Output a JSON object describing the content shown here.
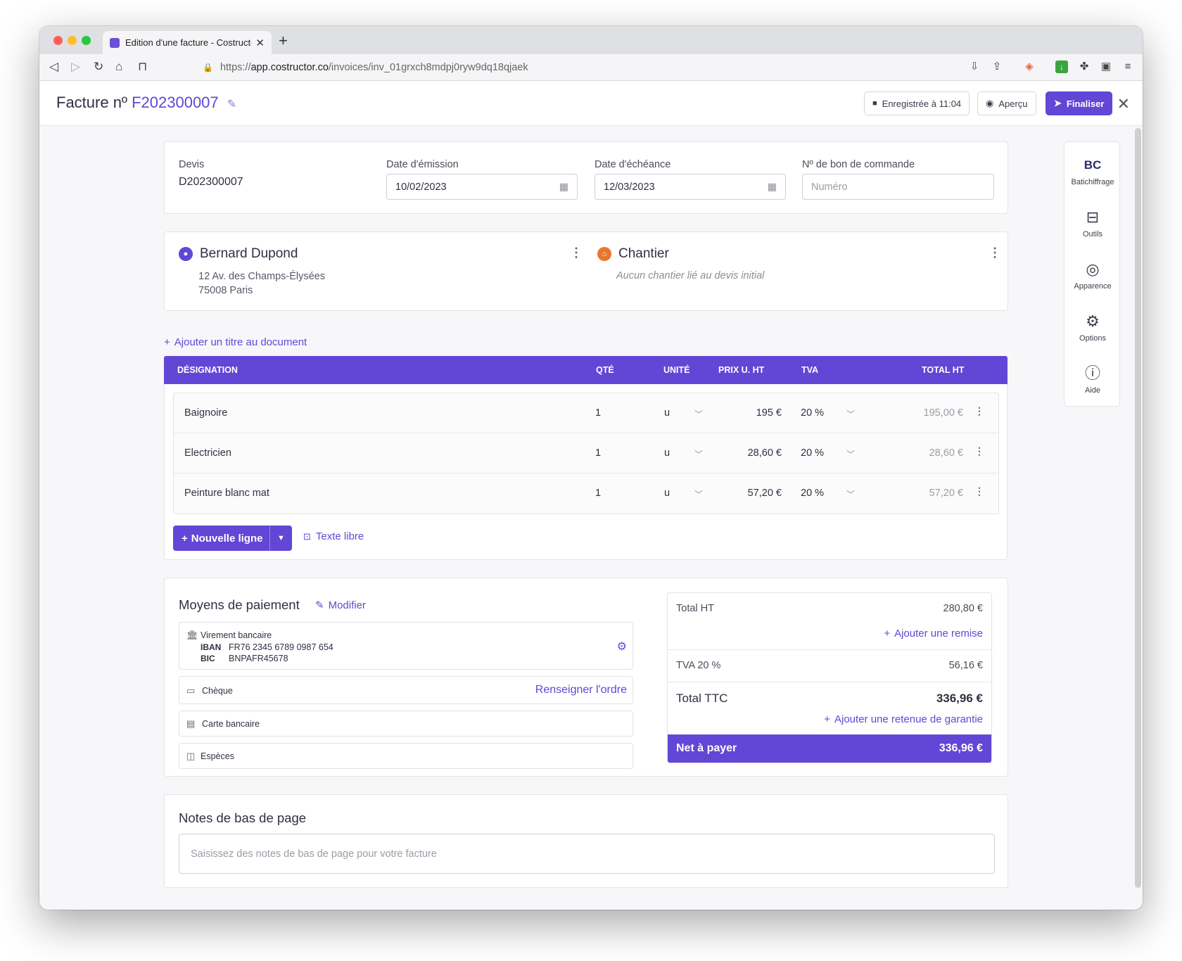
{
  "browser": {
    "tab_title": "Edition d'une facture - Costructor",
    "url_scheme": "https://",
    "url_host": "app.costructor.co",
    "url_path": "/invoices/inv_01grxch8mdpj0ryw9dq18qjaek"
  },
  "header": {
    "title_prefix": "Facture nº",
    "invoice_number": "F202300007",
    "saved_label": "Enregistrée à 11:04",
    "preview_label": "Aperçu",
    "finalize_label": "Finaliser"
  },
  "meta": {
    "quote_label": "Devis",
    "quote_value": "D202300007",
    "issue_label": "Date d'émission",
    "issue_value": "10/02/2023",
    "due_label": "Date d'échéance",
    "due_value": "12/03/2023",
    "po_label": "Nº de bon de commande",
    "po_placeholder": "Numéro"
  },
  "client": {
    "name": "Bernard Dupond",
    "address_line1": "12 Av. des Champs-Élysées",
    "address_line2": "75008 Paris"
  },
  "site": {
    "name": "Chantier",
    "empty_text": "Aucun chantier lié au devis initial"
  },
  "add_title_label": "Ajouter un titre au document",
  "table": {
    "headers": {
      "designation": "DÉSIGNATION",
      "qty": "QTÉ",
      "unit": "UNITÉ",
      "price": "PRIX U. HT",
      "vat": "TVA",
      "total": "TOTAL HT"
    },
    "rows": [
      {
        "designation": "Baignoire",
        "qty": "1",
        "unit": "u",
        "price": "195 €",
        "vat": "20 %",
        "total": "195,00 €"
      },
      {
        "designation": "Electricien",
        "qty": "1",
        "unit": "u",
        "price": "28,60 €",
        "vat": "20 %",
        "total": "28,60 €"
      },
      {
        "designation": "Peinture blanc mat",
        "qty": "1",
        "unit": "u",
        "price": "57,20 €",
        "vat": "20 %",
        "total": "57,20 €"
      }
    ],
    "new_line_label": "Nouvelle ligne",
    "free_text_label": "Texte libre"
  },
  "payment": {
    "title": "Moyens de paiement",
    "edit_label": "Modifier",
    "transfer_label": "Virement bancaire",
    "iban_label": "IBAN",
    "iban_value": "FR76 2345 6789 0987 654",
    "bic_label": "BIC",
    "bic_value": "BNPAFR45678",
    "cheque_label": "Chèque",
    "cheque_action": "Renseigner l'ordre",
    "card_label": "Carte bancaire",
    "cash_label": "Espèces"
  },
  "totals": {
    "total_ht_label": "Total HT",
    "total_ht_value": "280,80 €",
    "add_discount_label": "Ajouter une remise",
    "vat_label": "TVA 20 %",
    "vat_value": "56,16 €",
    "total_ttc_label": "Total TTC",
    "total_ttc_value": "336,96 €",
    "add_retention_label": "Ajouter une retenue de garantie",
    "net_label": "Net à payer",
    "net_value": "336,96 €"
  },
  "notes": {
    "title": "Notes de bas de page",
    "placeholder": "Saisissez des notes de bas de page pour votre facture"
  },
  "rail": {
    "items": [
      {
        "label": "Batichiffrage",
        "icon": "bc-logo"
      },
      {
        "label": "Outils",
        "icon": "toolbox-icon"
      },
      {
        "label": "Apparence",
        "icon": "palette-icon"
      },
      {
        "label": "Options",
        "icon": "gear-icon"
      },
      {
        "label": "Aide",
        "icon": "help-icon"
      }
    ],
    "bc_logo": "BC"
  },
  "colors": {
    "accent": "#6246d6",
    "traffic_red": "#fe5f57",
    "traffic_yellow": "#febc2e",
    "traffic_green": "#28c840"
  }
}
